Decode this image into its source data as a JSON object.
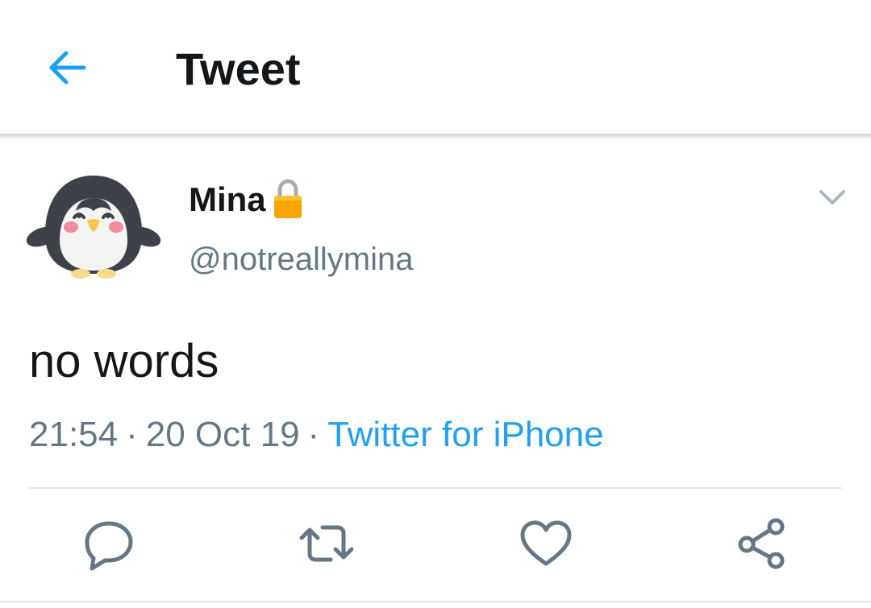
{
  "header": {
    "title": "Tweet",
    "back_icon": "arrow-left-icon"
  },
  "tweet": {
    "author_name": "Mina",
    "author_handle": "@notreallymina",
    "protected_icon": "lock-icon",
    "avatar_icon": "penguin-avatar",
    "text": "no words",
    "time": "21:54",
    "date": "20 Oct 19",
    "separator": "·",
    "source": "Twitter for iPhone"
  },
  "actions": [
    "reply-icon",
    "retweet-icon",
    "like-icon",
    "share-icon"
  ],
  "colors": {
    "accent": "#1da1f2",
    "secondary_text": "#657786",
    "icon": "#657786",
    "primary_text": "#14171a"
  }
}
